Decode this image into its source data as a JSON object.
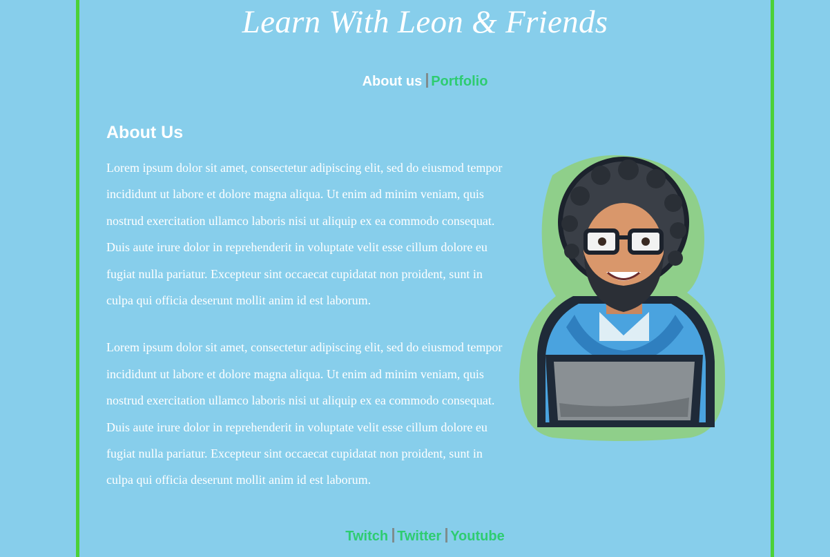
{
  "header": {
    "title": "Learn With Leon & Friends"
  },
  "nav": {
    "about_label": "About us",
    "portfolio_label": "Portfolio",
    "separator": "|"
  },
  "main": {
    "heading": "About Us",
    "paragraphs": [
      "Lorem ipsum dolor sit amet, consectetur adipiscing elit, sed do eiusmod tempor incididunt ut labore et dolore magna aliqua. Ut enim ad minim veniam, quis nostrud exercitation ullamco laboris nisi ut aliquip ex ea commodo consequat. Duis aute irure dolor in reprehenderit in voluptate velit esse cillum dolore eu fugiat nulla pariatur. Excepteur sint occaecat cupidatat non proident, sunt in culpa qui officia deserunt mollit anim id est laborum.",
      "Lorem ipsum dolor sit amet, consectetur adipiscing elit, sed do eiusmod tempor incididunt ut labore et dolore magna aliqua. Ut enim ad minim veniam, quis nostrud exercitation ullamco laboris nisi ut aliquip ex ea commodo consequat. Duis aute irure dolor in reprehenderit in voluptate velit esse cillum dolore eu fugiat nulla pariatur. Excepteur sint occaecat cupidatat non proident, sunt in culpa qui officia deserunt mollit anim id est laborum."
    ],
    "image_icon": "leon-avatar-illustration"
  },
  "footer": {
    "links": [
      "Twitch",
      "Twitter",
      "Youtube"
    ]
  },
  "colors": {
    "background": "#87ceeb",
    "border": "#4cd137",
    "link_green": "#2ecc71",
    "text": "#ffffff",
    "separator": "#7f8c8d"
  }
}
